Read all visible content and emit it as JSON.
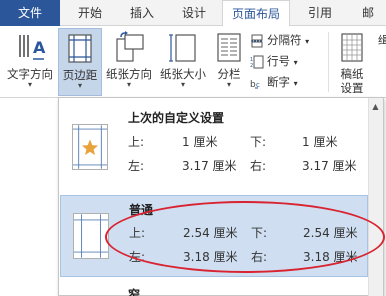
{
  "tabs": [
    {
      "label": "文件"
    },
    {
      "label": "开始"
    },
    {
      "label": "插入"
    },
    {
      "label": "设计"
    },
    {
      "label": "页面布局"
    },
    {
      "label": "引用"
    },
    {
      "label": "邮"
    }
  ],
  "ribbon": {
    "text_direction": "文字方向",
    "margins": "页边距",
    "orientation": "纸张方向",
    "size": "纸张大小",
    "columns": "分栏",
    "breaks": "分隔符",
    "line_numbers": "行号",
    "hyphenation": "断字",
    "draft_paper_line1": "稿纸",
    "draft_paper_line2": "设置",
    "cut": "缉",
    "dropdown_arrow": "▾",
    "small_arrow": "▾"
  },
  "gallery": {
    "options": [
      {
        "title": "上次的自定义设置",
        "top_label": "上:",
        "top_value": "1 厘米",
        "bottom_label": "下:",
        "bottom_value": "1 厘米",
        "left_label": "左:",
        "left_value": "3.17 厘米",
        "right_label": "右:",
        "right_value": "3.17 厘米"
      },
      {
        "title": "普通",
        "top_label": "上:",
        "top_value": "2.54 厘米",
        "bottom_label": "下:",
        "bottom_value": "2.54 厘米",
        "left_label": "左:",
        "left_value": "3.18 厘米",
        "right_label": "右:",
        "right_value": "3.18 厘米"
      },
      {
        "title": "窄"
      }
    ]
  },
  "colors": {
    "accent": "#2b579a",
    "selection": "#cfdff1",
    "annotation": "#d92330",
    "star": "#e8a33c"
  },
  "icons": {
    "text_direction": "text-direction-icon",
    "margins": "margins-icon",
    "orientation": "orientation-icon",
    "size": "page-size-icon",
    "columns": "columns-icon",
    "breaks": "breaks-icon",
    "line_numbers": "line-numbers-icon",
    "hyphenation": "hyphenation-icon",
    "draft_paper": "draft-paper-icon"
  }
}
